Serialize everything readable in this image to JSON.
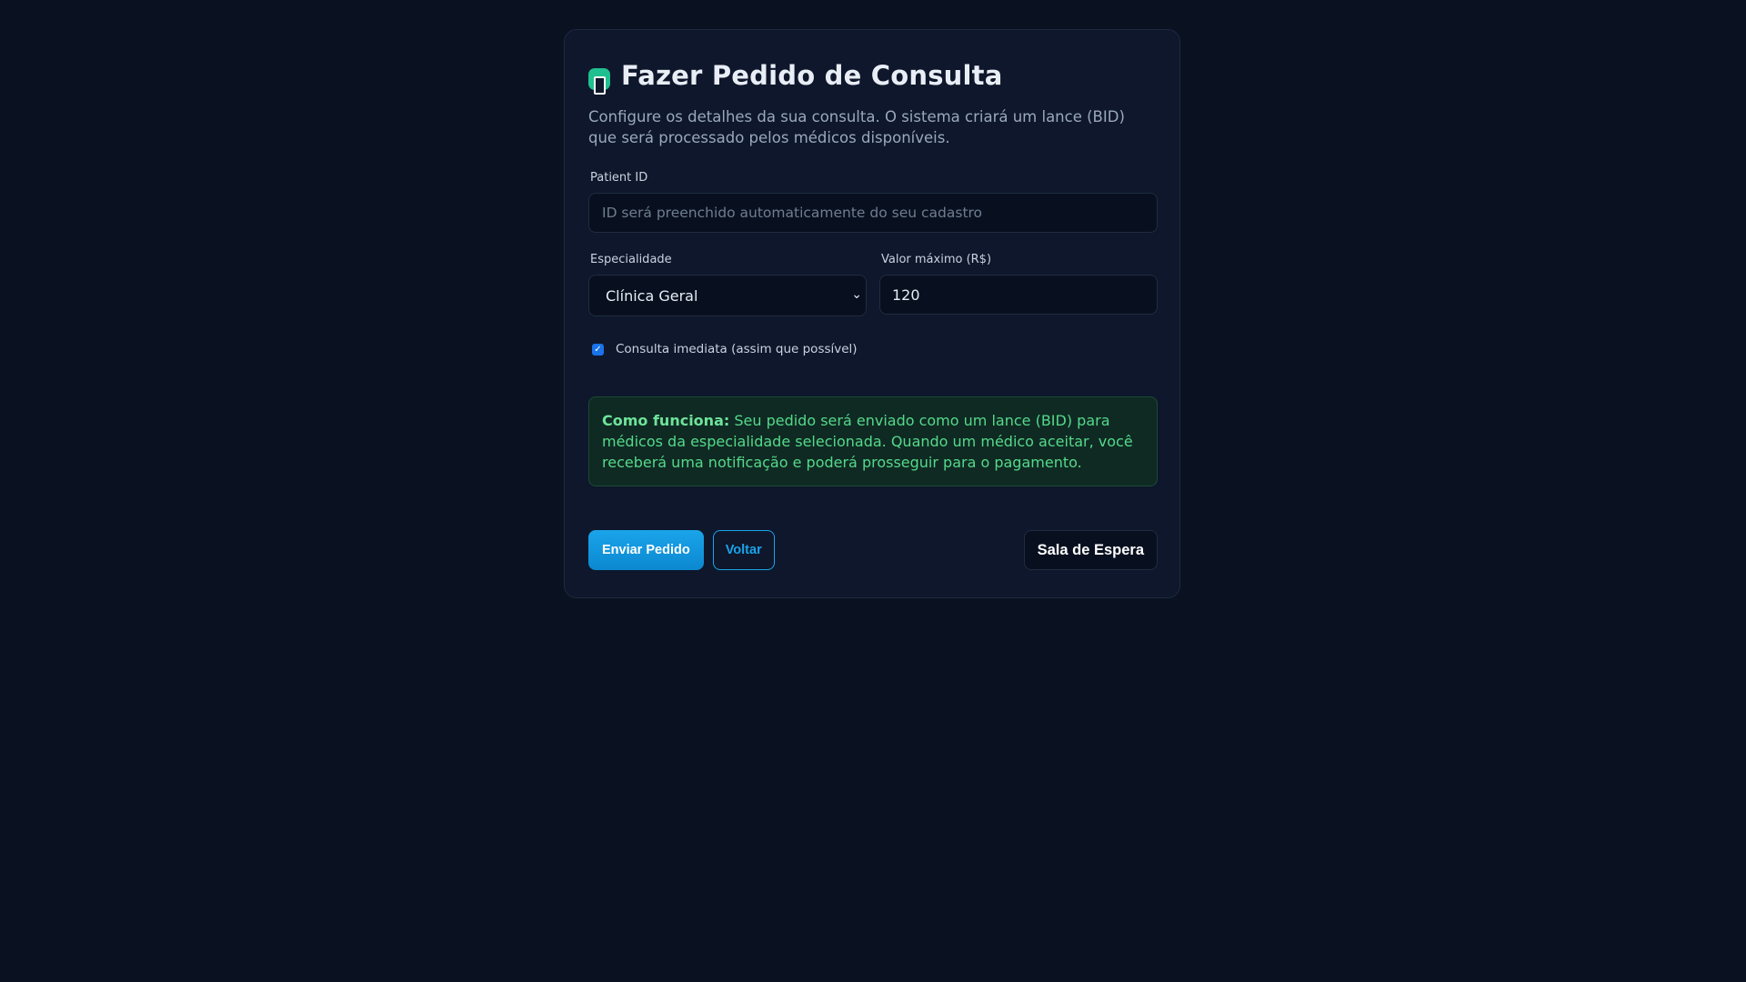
{
  "header": {
    "title": "Fazer Pedido de Consulta",
    "icon": "phone-icon",
    "icon_color": "#1fbf8f"
  },
  "description": "Configure os detalhes da sua consulta. O sistema criará um lance (BID) que será processado pelos médicos disponíveis.",
  "form": {
    "patient_id": {
      "label": "Patient ID",
      "value": "",
      "placeholder": "ID será preenchido automaticamente do seu cadastro"
    },
    "especialidade": {
      "label": "Especialidade",
      "selected": "Clínica Geral"
    },
    "valor_maximo": {
      "label": "Valor máximo (R$)",
      "value": "120"
    },
    "consulta_imediata": {
      "label": "Consulta imediata (assim que possível)",
      "checked": true
    }
  },
  "info_box": {
    "title": "Como funciona:",
    "text": " Seu pedido será enviado como um lance (BID) para médicos da especialidade selecionada. Quando um médico aceitar, você receberá uma notificação e poderá prosseguir para o pagamento."
  },
  "buttons": {
    "submit": "Enviar Pedido",
    "back": "Voltar",
    "waiting_room": "Sala de Espera"
  },
  "colors": {
    "accent": "#1aa4ea",
    "success_text": "#55d98a",
    "background": "#0a1120"
  }
}
